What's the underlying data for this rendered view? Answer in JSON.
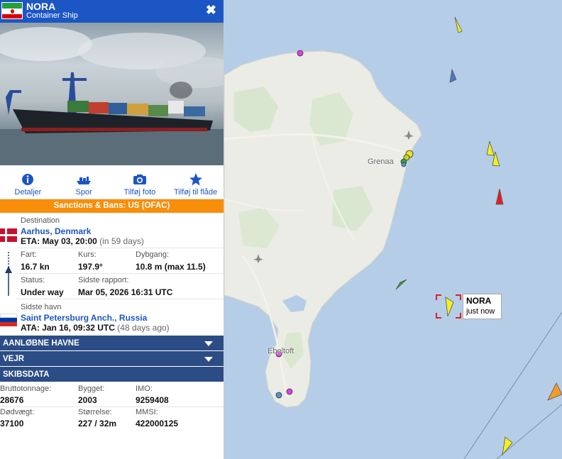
{
  "vessel": {
    "name": "NORA",
    "type": "Container Ship",
    "close_glyph": "✖"
  },
  "actions": [
    {
      "label": "Detaljer",
      "icon": "info-icon"
    },
    {
      "label": "Spor",
      "icon": "ship-track-icon"
    },
    {
      "label": "Tilføj foto",
      "icon": "camera-icon"
    },
    {
      "label": "Tilføj til flåde",
      "icon": "star-icon"
    }
  ],
  "sanctions": "Sanctions & Bans: US (OFAC)",
  "destination": {
    "label": "Destination",
    "port": "Aarhus, Denmark",
    "eta_prefix": "ETA: May 03, 20:00",
    "eta_relative": "(in 59 days)"
  },
  "voyage": {
    "speed_label": "Fart:",
    "speed_value": "16.7 kn",
    "course_label": "Kurs:",
    "course_value": "197.9°",
    "draught_label": "Dybgang:",
    "draught_value": "10.8 m (max 11.5)",
    "status_label": "Status:",
    "status_value": "Under way",
    "report_label": "Sidste rapport:",
    "report_value": "Mar 05, 2026 16:31 UTC"
  },
  "last_port": {
    "label": "Sidste havn",
    "port": "Saint Petersburg Anch., Russia",
    "ata_prefix": "ATA: Jan 16, 09:32 UTC",
    "ata_relative": "(48 days ago)"
  },
  "sections": {
    "ports": "AANLØBNE HAVNE",
    "weather": "VEJR",
    "shipdata": "SKIBSDATA"
  },
  "shipdata": {
    "gt_label": "Bruttotonnage:",
    "gt_value": "28676",
    "built_label": "Bygget:",
    "built_value": "2003",
    "imo_label": "IMO:",
    "imo_value": "9259408",
    "dwt_label": "Dødvægt:",
    "dwt_value": "37100",
    "size_label": "Størrelse:",
    "size_value": "227 / 32m",
    "mmsi_label": "MMSI:",
    "mmsi_value": "422000125"
  },
  "map": {
    "places": {
      "grenaa": "Grenaa",
      "ebeltoft": "Ebeltoft"
    },
    "tooltip": {
      "name": "NORA",
      "time": "just now"
    }
  }
}
